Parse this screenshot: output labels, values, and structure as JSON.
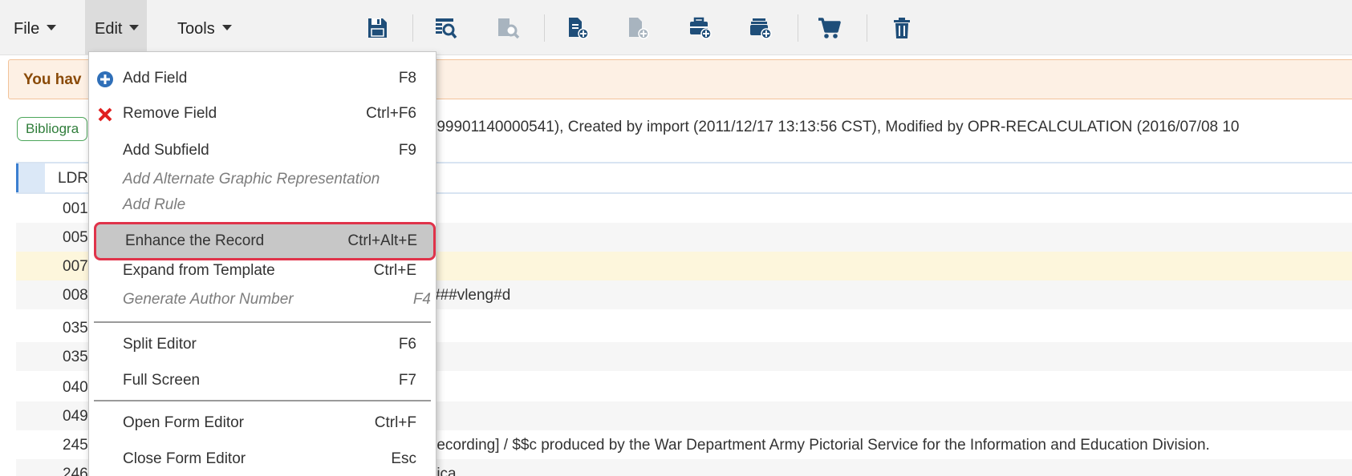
{
  "menubar": {
    "file": "File",
    "edit": "Edit",
    "tools": "Tools"
  },
  "toolbar": {
    "icons": [
      "save-icon",
      "search-record-icon",
      "search-record-disabled-icon",
      "new-record-icon",
      "new-record-disabled-icon",
      "new-portfolio-icon",
      "new-collection-icon",
      "cart-icon",
      "trash-icon"
    ]
  },
  "warning": {
    "text": "You hav"
  },
  "record": {
    "badge": "Bibliogra",
    "info": "(99901140000541), Created by import (2011/12/17 13:13:56 CST), Modified by OPR-RECALCULATION (2016/07/08 10"
  },
  "ldr": {
    "tag": "LDR"
  },
  "fields": [
    {
      "tag": "001",
      "value": ""
    },
    {
      "tag": "005",
      "value": ""
    },
    {
      "tag": "007",
      "value": ""
    },
    {
      "tag": "008",
      "value": "###vleng#d"
    },
    {
      "tag": "035",
      "value": ""
    },
    {
      "tag": "035",
      "value": ""
    },
    {
      "tag": "040",
      "value": ""
    },
    {
      "tag": "049",
      "value": ""
    },
    {
      "tag": "245",
      "value": "recording] / $$c produced by the War Department Army Pictorial Service for the Information and Education Division."
    },
    {
      "tag": "246",
      "value": "rica"
    }
  ],
  "edit_menu": {
    "items": [
      {
        "label": "Add Field",
        "shortcut": "F8"
      },
      {
        "label": "Remove Field",
        "shortcut": "Ctrl+F6"
      },
      {
        "label": "Add Subfield",
        "shortcut": "F9"
      },
      {
        "label": "Add Alternate Graphic Representation",
        "shortcut": ""
      },
      {
        "label": "Add Rule",
        "shortcut": ""
      },
      {
        "label": "Enhance the Record",
        "shortcut": "Ctrl+Alt+E"
      },
      {
        "label": "Expand from Template",
        "shortcut": "Ctrl+E"
      },
      {
        "label": "Generate Author Number",
        "shortcut": "F4"
      },
      {
        "label": "Split Editor",
        "shortcut": "F6"
      },
      {
        "label": "Full Screen",
        "shortcut": "F7"
      },
      {
        "label": "Open Form Editor",
        "shortcut": "Ctrl+F"
      },
      {
        "label": "Close Form Editor",
        "shortcut": "Esc"
      }
    ]
  },
  "colors": {
    "highlight_border": "#e0334a",
    "toolbar_icon": "#1f4e79",
    "disabled_icon": "#a8b4bf"
  }
}
